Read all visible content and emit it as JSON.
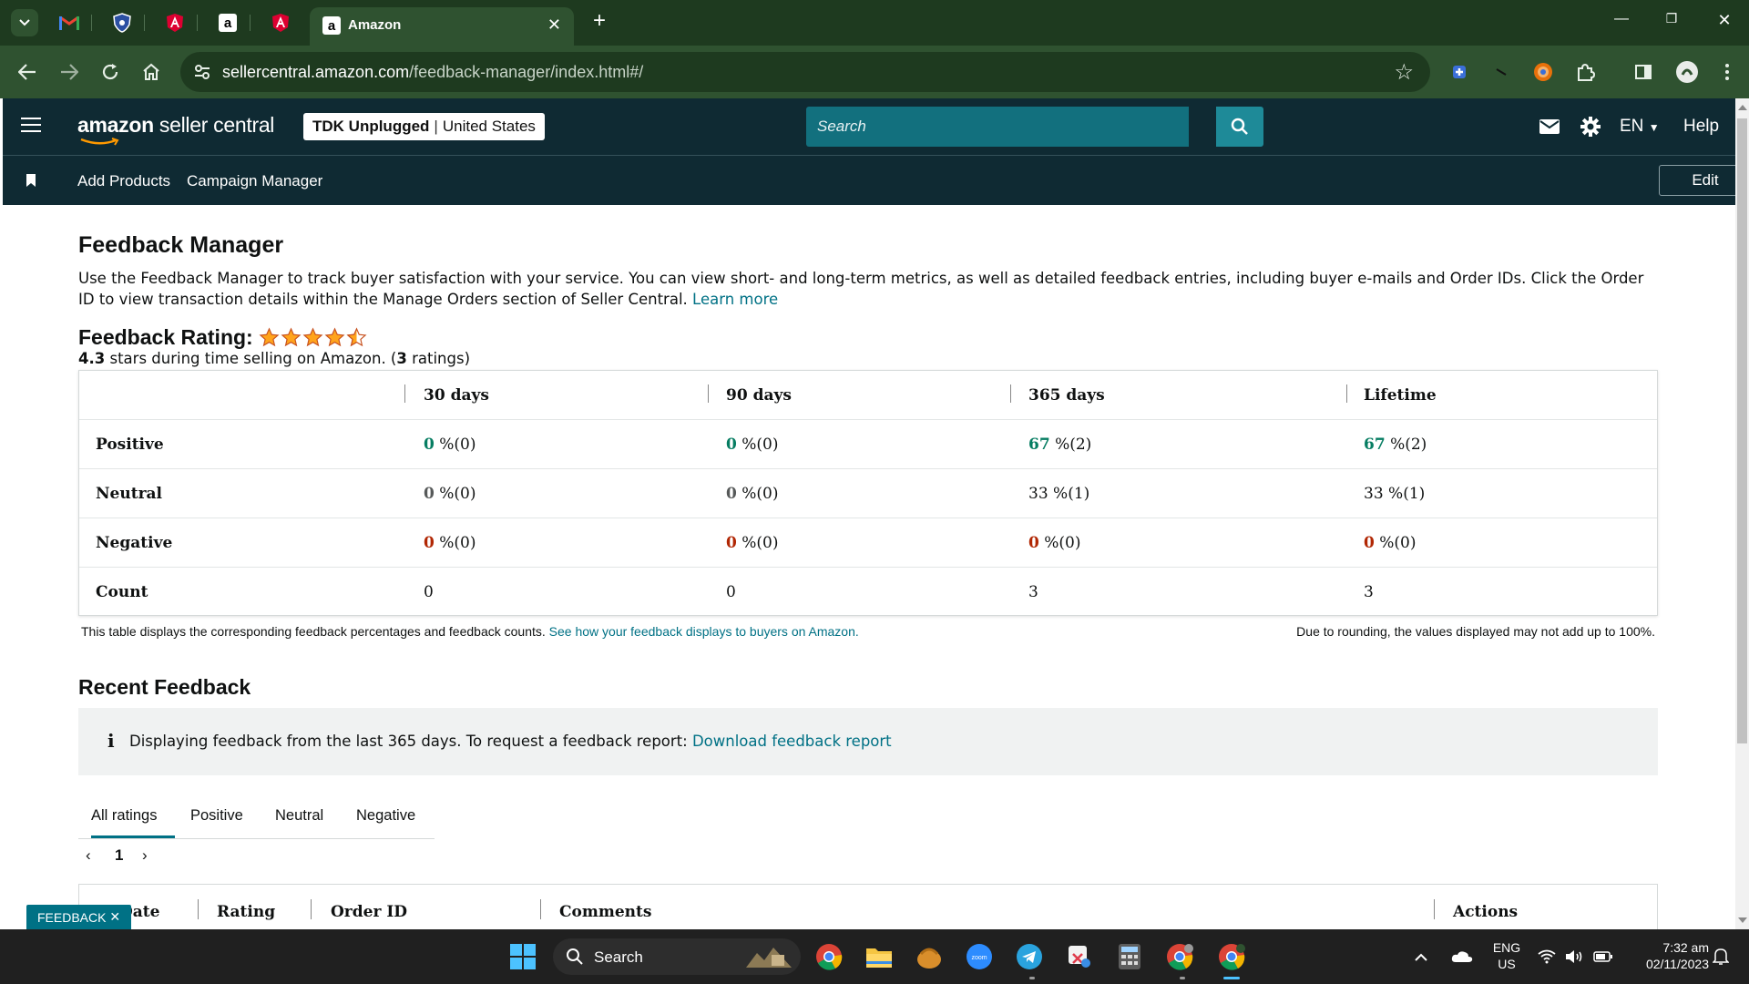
{
  "browser": {
    "active_tab_title": "Amazon",
    "url_host": "sellercentral.amazon.com",
    "url_path": "/feedback-manager/index.html#/"
  },
  "header": {
    "logo_bold": "amazon",
    "logo_rest": " seller central",
    "store_name": "TDK Unplugged",
    "store_region": "United States",
    "search_placeholder": "Search",
    "language": "EN",
    "help": "Help"
  },
  "subnav": {
    "items": [
      "Add Products",
      "Campaign Manager"
    ],
    "edit_label": "Edit"
  },
  "page": {
    "title": "Feedback Manager",
    "intro": "Use the Feedback Manager to track buyer satisfaction with your service. You can view short- and long-term metrics, as well as detailed feedback entries, including buyer e-mails and Order IDs. Click the Order ID to view transaction details within the Manage Orders section of Seller Central.",
    "learn_more": "Learn more"
  },
  "rating": {
    "title": "Feedback Rating:",
    "stars_value": 4.3,
    "stars_max": 5,
    "avg": "4.3",
    "sub_mid": " stars during time selling on Amazon. (",
    "count": "3",
    "sub_end": " ratings)"
  },
  "feedback_table": {
    "columns": [
      "30 days",
      "90 days",
      "365 days",
      "Lifetime"
    ],
    "rows": [
      {
        "label": "Positive",
        "cells": [
          {
            "num": "0",
            "rest": " %(0)"
          },
          {
            "num": "0",
            "rest": " %(0)"
          },
          {
            "num": "67",
            "rest": " %(2)"
          },
          {
            "num": "67",
            "rest": " %(2)"
          }
        ]
      },
      {
        "label": "Neutral",
        "cells": [
          {
            "num": "0",
            "rest": " %(0)"
          },
          {
            "num": "0",
            "rest": " %(0)"
          },
          {
            "num": "33",
            "rest": " %(1)"
          },
          {
            "num": "33",
            "rest": " %(1)"
          }
        ]
      },
      {
        "label": "Negative",
        "cells": [
          {
            "num": "0",
            "rest": " %(0)"
          },
          {
            "num": "0",
            "rest": " %(0)"
          },
          {
            "num": "0",
            "rest": " %(0)"
          },
          {
            "num": "0",
            "rest": " %(0)"
          }
        ]
      },
      {
        "label": "Count",
        "cells": [
          {
            "num": "",
            "rest": "0"
          },
          {
            "num": "",
            "rest": "0"
          },
          {
            "num": "",
            "rest": "3"
          },
          {
            "num": "",
            "rest": "3"
          }
        ]
      }
    ],
    "note": "This table displays the corresponding feedback percentages and feedback counts.",
    "note_link": "See how your feedback displays to buyers on Amazon.",
    "rounding_note": "Due to rounding, the values displayed may not add up to 100%."
  },
  "recent": {
    "title": "Recent Feedback",
    "info_text": "Displaying feedback from the last 365 days. To request a feedback report:",
    "info_link": "Download feedback report",
    "tabs": [
      "All ratings",
      "Positive",
      "Neutral",
      "Negative"
    ],
    "page": "1",
    "columns": [
      "Date",
      "Rating",
      "Order ID",
      "Comments",
      "Actions"
    ]
  },
  "feedback_badge": "FEEDBACK",
  "taskbar": {
    "search_label": "Search",
    "lang_top": "ENG",
    "lang_bottom": "US",
    "time": "7:32 am",
    "date": "02/11/2023"
  },
  "colors": {
    "header_bg": "#0f2a33",
    "search_bg": "#12707e",
    "search_btn": "#1e8a98",
    "link": "#007185",
    "positive": "#067d62",
    "negative": "#b12704",
    "star": "#ffa41c",
    "browser_dark": "#1e3a1f",
    "browser_mid": "#2f5230"
  }
}
